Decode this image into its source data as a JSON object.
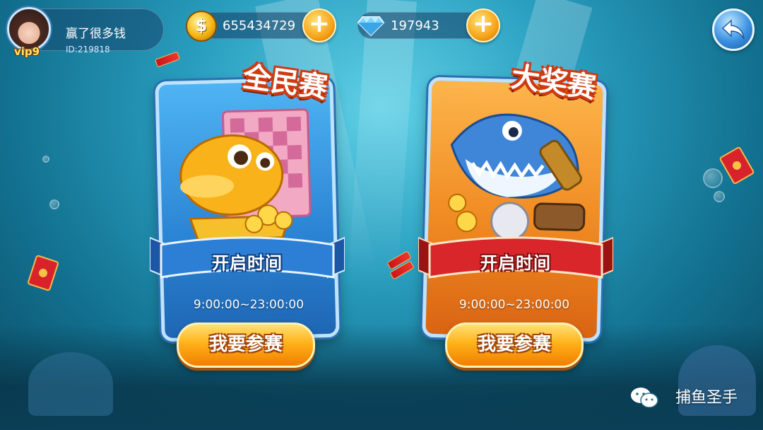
{
  "profile": {
    "username": "赢了很多钱",
    "user_id": "ID:219818",
    "vip_label": "vip9"
  },
  "currency": {
    "coins": "655434729",
    "diamonds": "197943",
    "plus_label": "+"
  },
  "cards": [
    {
      "title": "全民赛",
      "ribbon_label": "开启时间",
      "time_range": "9:00:00~23:00:00",
      "join_label": "我要参赛",
      "theme_color": "#2b84d4"
    },
    {
      "title": "大奖赛",
      "ribbon_label": "开启时间",
      "time_range": "9:00:00~23:00:00",
      "join_label": "我要参赛",
      "theme_color": "#f08a22"
    }
  ],
  "watermark": {
    "text": "捕鱼圣手",
    "icon": "wechat-icon"
  },
  "icons": {
    "coin": "coin-icon",
    "diamond": "diamond-icon",
    "back": "back-arrow-icon"
  }
}
